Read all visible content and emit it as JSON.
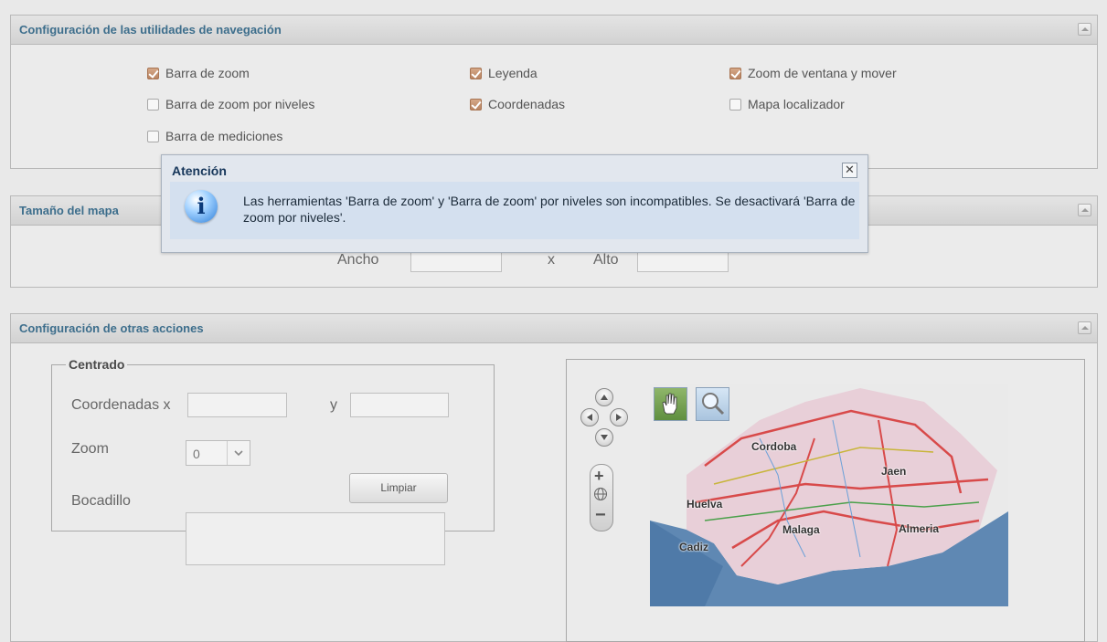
{
  "nav_panel": {
    "title": "Configuración de las utilidades de navegación",
    "options": [
      {
        "label": "Barra de zoom",
        "checked": true
      },
      {
        "label": "Leyenda",
        "checked": true
      },
      {
        "label": "Zoom de ventana y mover",
        "checked": true
      },
      {
        "label": "Barra de zoom por niveles",
        "checked": false
      },
      {
        "label": "Coordenadas",
        "checked": true
      },
      {
        "label": "Mapa localizador",
        "checked": false
      },
      {
        "label": "Barra de mediciones",
        "checked": false
      }
    ]
  },
  "size_panel": {
    "title": "Tamaño del mapa",
    "width_label": "Ancho",
    "separator": "x",
    "height_label": "Alto"
  },
  "actions_panel": {
    "title": "Configuración de otras acciones",
    "centrado": {
      "legend": "Centrado",
      "coord_label": "Coordenadas x",
      "y_label": "y",
      "zoom_label": "Zoom",
      "zoom_value": "0",
      "clear_button": "Limpiar",
      "bocadillo_label": "Bocadillo"
    },
    "map": {
      "cities": [
        "Cordoba",
        "Jaen",
        "Huelva",
        "Malaga",
        "Almeria",
        "Cadiz"
      ]
    }
  },
  "dialog": {
    "title": "Atención",
    "message": "Las herramientas 'Barra de zoom' y 'Barra de zoom' por niveles son incompatibles. Se desactivará 'Barra de zoom por niveles'.",
    "close_symbol": "✕"
  },
  "colors": {
    "panel_title": "#3d6e8c",
    "checked_box": "#c08a66",
    "dialog_bg": "#d4e0ef"
  }
}
